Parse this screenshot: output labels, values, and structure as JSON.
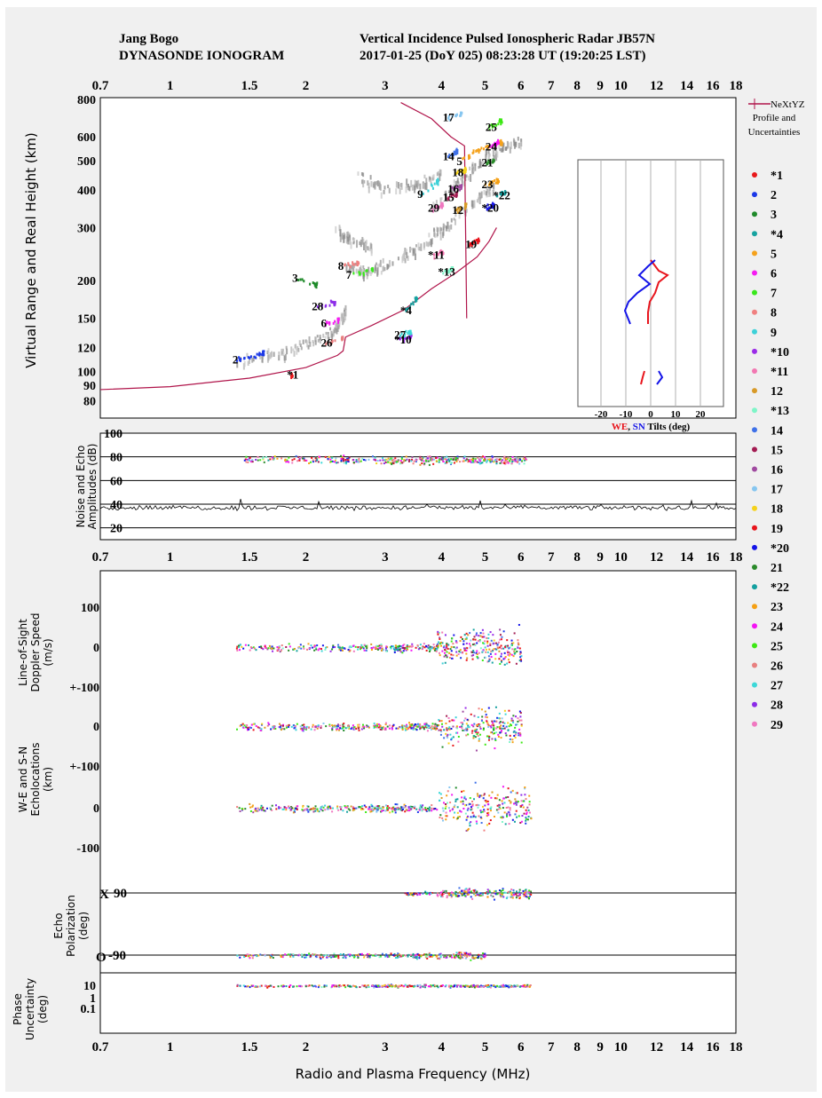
{
  "header": {
    "station": "Jang Bogo",
    "product": "DYNASONDE   IONOGRAM",
    "instrument": "Vertical Incidence Pulsed Ionospheric Radar JB57N",
    "datetime": "2017-01-25 (DoY 025)    08:23:28 UT  (19:20:25  LST)"
  },
  "chart_data": {
    "type": "scatter",
    "x_scale": "log",
    "xlim": [
      0.7,
      18
    ],
    "x_ticks": [
      "0.7",
      "1",
      "1.5",
      "2",
      "3",
      "4",
      "5",
      "6",
      "7",
      "8",
      "9",
      "10",
      "12",
      "14",
      "16",
      "18"
    ],
    "xlabel": "Radio and Plasma Frequency (MHz)",
    "panels": {
      "ionogram": {
        "ylabel": "Virtual Range and Real Height (km)",
        "y_scale": "log",
        "ylim": [
          70,
          810
        ],
        "y_ticks": [
          "800",
          "600",
          "500",
          "400",
          "300",
          "200",
          "150",
          "120",
          "100",
          "90",
          "80"
        ],
        "profile_label": "NeXtYZ",
        "profile_caption": [
          "Profile and",
          "Uncertainties"
        ],
        "profile": [
          [
            0.7,
            87
          ],
          [
            1.0,
            89
          ],
          [
            1.5,
            95
          ],
          [
            2.0,
            103
          ],
          [
            2.35,
            113
          ],
          [
            2.42,
            117
          ],
          [
            2.45,
            130
          ],
          [
            2.8,
            142
          ],
          [
            3.3,
            160
          ],
          [
            3.8,
            188
          ],
          [
            4.3,
            212
          ],
          [
            4.8,
            240
          ],
          [
            5.1,
            270
          ],
          [
            5.3,
            300
          ]
        ],
        "traces": [
          {
            "id": "*1",
            "freq": [
              1.85
            ],
            "range": [
              98
            ]
          },
          {
            "id": "2",
            "freq": [
              1.4,
              1.5,
              1.6
            ],
            "range": [
              110,
              112,
              116
            ]
          },
          {
            "id": "3",
            "freq": [
              1.9,
              2.1
            ],
            "range": [
              205,
              195
            ]
          },
          {
            "id": "*4",
            "freq": [
              3.3,
              3.5
            ],
            "range": [
              160,
              175
            ]
          },
          {
            "id": "5",
            "freq": [
              4.4,
              4.7,
              5.0,
              5.4
            ],
            "range": [
              500,
              540,
              560,
              580
            ]
          },
          {
            "id": "6",
            "freq": [
              2.2,
              2.35
            ],
            "range": [
              145,
              150
            ]
          },
          {
            "id": "7",
            "freq": [
              2.5,
              2.8
            ],
            "range": [
              210,
              220
            ]
          },
          {
            "id": "8",
            "freq": [
              2.4,
              2.6
            ],
            "range": [
              225,
              230
            ]
          },
          {
            "id": "9",
            "freq": [
              3.6,
              3.9
            ],
            "range": [
              390,
              430
            ]
          },
          {
            "id": "*10",
            "freq": [
              3.2,
              3.4
            ],
            "range": [
              128,
              132
            ]
          },
          {
            "id": "*11",
            "freq": [
              3.8,
              4.0
            ],
            "range": [
              245,
              250
            ]
          },
          {
            "id": "12",
            "freq": [
              4.3,
              4.5
            ],
            "range": [
              345,
              355
            ]
          },
          {
            "id": "*13",
            "freq": [
              4.0,
              4.2
            ],
            "range": [
              215,
              220
            ]
          },
          {
            "id": "14",
            "freq": [
              4.1,
              4.3
            ],
            "range": [
              520,
              540
            ]
          },
          {
            "id": "15",
            "freq": [
              4.1,
              4.3
            ],
            "range": [
              380,
              390
            ]
          },
          {
            "id": "16",
            "freq": [
              4.2,
              4.4
            ],
            "range": [
              405,
              415
            ]
          },
          {
            "id": "17",
            "freq": [
              4.1,
              4.4
            ],
            "range": [
              700,
              720
            ]
          },
          {
            "id": "18",
            "freq": [
              4.3,
              4.5
            ],
            "range": [
              460,
              470
            ]
          },
          {
            "id": "19",
            "freq": [
              4.6,
              4.8
            ],
            "range": [
              265,
              275
            ]
          },
          {
            "id": "*20",
            "freq": [
              5.0,
              5.2
            ],
            "range": [
              350,
              360
            ]
          },
          {
            "id": "21",
            "freq": [
              5.0,
              5.2
            ],
            "range": [
              495,
              505
            ]
          },
          {
            "id": "*22",
            "freq": [
              5.3,
              5.5
            ],
            "range": [
              385,
              395
            ]
          },
          {
            "id": "23",
            "freq": [
              5.0,
              5.3
            ],
            "range": [
              420,
              430
            ]
          },
          {
            "id": "24",
            "freq": [
              5.1,
              5.3
            ],
            "range": [
              560,
              580
            ]
          },
          {
            "id": "25",
            "freq": [
              5.1,
              5.4
            ],
            "range": [
              650,
              680
            ]
          },
          {
            "id": "26",
            "freq": [
              2.2,
              2.4
            ],
            "range": [
              125,
              130
            ]
          },
          {
            "id": "27",
            "freq": [
              3.2,
              3.4
            ],
            "range": [
              133,
              136
            ]
          },
          {
            "id": "28",
            "freq": [
              2.1,
              2.3
            ],
            "range": [
              165,
              170
            ]
          },
          {
            "id": "29",
            "freq": [
              3.8,
              4.0
            ],
            "range": [
              350,
              360
            ]
          }
        ]
      },
      "tilts": {
        "xticks": [
          "-20",
          "-10",
          "0",
          "10",
          "20"
        ],
        "xlabel_we": "WE",
        "xlabel_sep": ",",
        "xlabel_sn": "SN",
        "xlabel_rest": "Tilts (deg)"
      },
      "amplitudes": {
        "ylabel": [
          "Noise and Echo",
          "Amplitudes (dB)"
        ],
        "ylim": [
          10,
          100
        ],
        "y_ticks": [
          "100",
          "80",
          "60",
          "40",
          "20"
        ],
        "noise_level_db": 37,
        "echo_level_db": 78
      },
      "doppler": {
        "ylabel": [
          "Line-of-Sight",
          "Doppler Speed",
          "(m/s)"
        ],
        "y_ticks": [
          "100",
          "0",
          "+-100"
        ]
      },
      "echolocations": {
        "ylabel": [
          "W-E  and  S-N",
          "Echolocations",
          "(km)"
        ],
        "y_ticks": [
          "0",
          "+-100",
          "0",
          "-100"
        ]
      },
      "polarization": {
        "ylabel": [
          "Echo",
          "Polarization",
          "(deg)"
        ],
        "x_mode": "X",
        "x_value": "90",
        "o_mode": "O",
        "o_value": "-90"
      },
      "phase": {
        "ylabel": [
          "Phase",
          "Uncertainty",
          "(deg)"
        ],
        "y_ticks": [
          "10",
          "1",
          "0.1"
        ]
      }
    },
    "legend": {
      "ids": [
        "*1",
        "2",
        "3",
        "*4",
        "5",
        "6",
        "7",
        "8",
        "9",
        "*10",
        "*11",
        "12",
        "*13",
        "14",
        "15",
        "16",
        "17",
        "18",
        "19",
        "*20",
        "21",
        "*22",
        "23",
        "24",
        "25",
        "26",
        "27",
        "28",
        "29"
      ],
      "colors": [
        "#e8191c",
        "#1c39e8",
        "#1f8a2a",
        "#17a3a0",
        "#f5a21c",
        "#f51cf2",
        "#39e81c",
        "#f08080",
        "#3dd1d8",
        "#9b2ce8",
        "#f278b2",
        "#d89a28",
        "#7ff5c8",
        "#3f71e8",
        "#a31c52",
        "#a04aa0",
        "#86c6f0",
        "#f5d21c",
        "#e8141c",
        "#1414e8",
        "#2a8a2a",
        "#14a0a0",
        "#f5a014",
        "#f514f5",
        "#3de814",
        "#e88080",
        "#3dd8d8",
        "#8c2ce8",
        "#f078c0"
      ]
    }
  }
}
